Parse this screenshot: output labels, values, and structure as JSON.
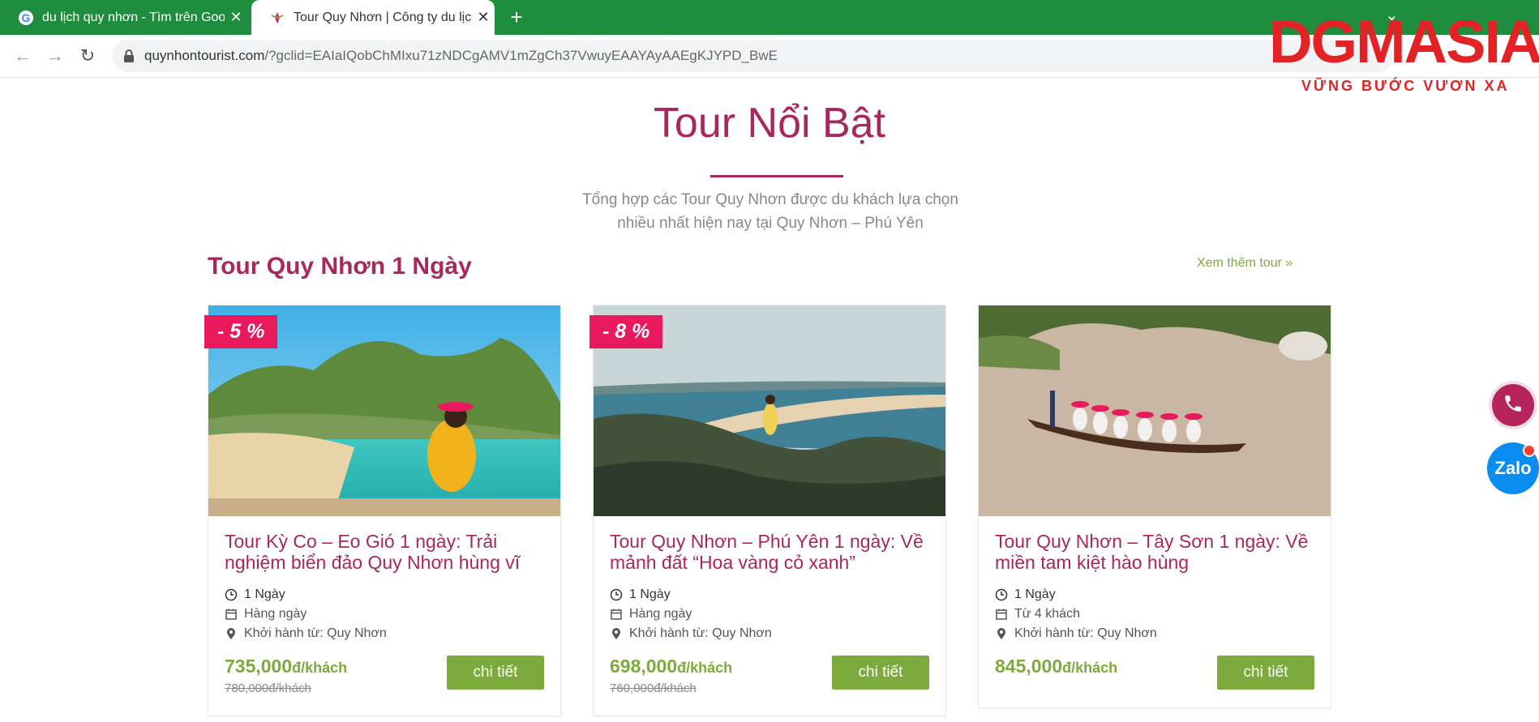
{
  "browser": {
    "tabs": [
      {
        "title": "du lịch quy nhơn - Tìm trên Goo",
        "favicon": "google-icon"
      },
      {
        "title": "Tour Quy Nhơn | Công ty du lịch",
        "favicon": "site-icon"
      }
    ],
    "url_host": "quynhontourist.com",
    "url_rest": "/?gclid=EAIaIQobChMIxu71zNDCgAMV1mZgCh37VwuyEAAYAyAAEgKJYPD_BwE"
  },
  "watermark": {
    "brand": "DGMASIA",
    "tagline": "VỮNG BƯỚC VƯƠN XA"
  },
  "section": {
    "title": "Tour Nổi Bật",
    "subtitle_line1": "Tổng hợp các Tour Quy Nhơn được du khách lựa chọn",
    "subtitle_line2": "nhiều nhất hiện nay tại Quy Nhơn – Phú Yên"
  },
  "category": {
    "title": "Tour Quy Nhơn 1 Ngày",
    "see_more": "Xem thêm tour »"
  },
  "cards": [
    {
      "badge": "- 5 %",
      "name": "Tour Kỳ Co – Eo Gió 1 ngày: Trải nghiệm biển đảo Quy Nhơn hùng vĩ",
      "duration": "1 Ngày",
      "schedule": "Hàng ngày",
      "departure": "Khởi hành từ: Quy Nhơn",
      "price": "735,000",
      "unit": "đ/khách",
      "old_price": "780,000đ/khách",
      "button": "chi tiết"
    },
    {
      "badge": "- 8 %",
      "name": "Tour Quy Nhơn – Phú Yên 1 ngày: Về mảnh đất “Hoa vàng cỏ xanh”",
      "duration": "1 Ngày",
      "schedule": "Hàng ngày",
      "departure": "Khởi hành từ: Quy Nhơn",
      "price": "698,000",
      "unit": "đ/khách",
      "old_price": "760,000đ/khách",
      "button": "chi tiết"
    },
    {
      "badge": "",
      "name": "Tour Quy Nhơn – Tây Sơn 1 ngày: Về miền tam kiệt hào hùng",
      "duration": "1 Ngày",
      "schedule": "Từ 4 khách",
      "departure": "Khởi hành từ: Quy Nhơn",
      "price": "845,000",
      "unit": "đ/khách",
      "old_price": "",
      "button": "chi tiết"
    }
  ],
  "floating": {
    "zalo_label": "Zalo"
  },
  "colors": {
    "brand": "#a8285d",
    "accent_green": "#7daa3c",
    "badge": "#e8195c",
    "tabbar": "#1e8e3e"
  }
}
